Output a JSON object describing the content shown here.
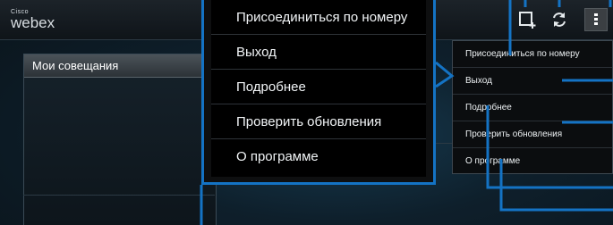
{
  "app": {
    "logo_small": "Cisco",
    "logo_main": "webex"
  },
  "left_panel": {
    "header": "Мои совещания"
  },
  "menu": {
    "items": [
      "Присоединиться по номеру",
      "Выход",
      "Подробнее",
      "Проверить обновления",
      "О программе"
    ]
  },
  "toolbar": {
    "icons": [
      "add-meeting-icon",
      "refresh-icon",
      "overflow-menu-icon"
    ]
  },
  "colors": {
    "callout_blue": "#1473c4",
    "menu_bg": "#000000"
  }
}
